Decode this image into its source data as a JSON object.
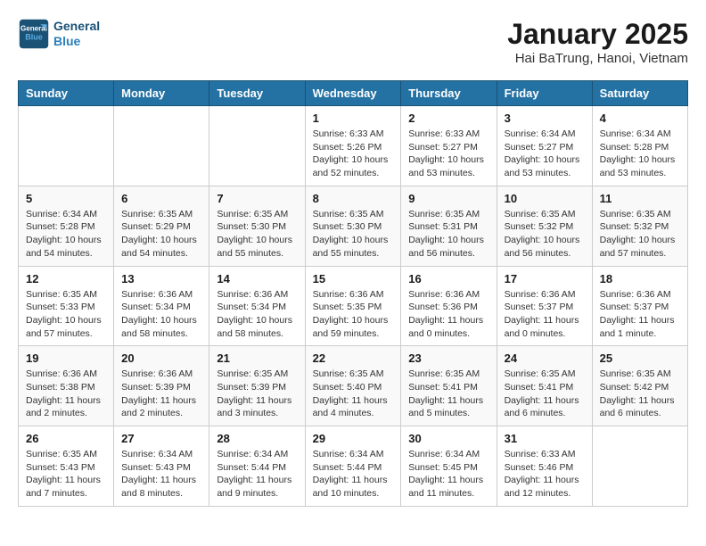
{
  "header": {
    "logo_line1": "General",
    "logo_line2": "Blue",
    "title": "January 2025",
    "subtitle": "Hai BaTrung, Hanoi, Vietnam"
  },
  "weekdays": [
    "Sunday",
    "Monday",
    "Tuesday",
    "Wednesday",
    "Thursday",
    "Friday",
    "Saturday"
  ],
  "weeks": [
    [
      {
        "day": "",
        "info": ""
      },
      {
        "day": "",
        "info": ""
      },
      {
        "day": "",
        "info": ""
      },
      {
        "day": "1",
        "info": "Sunrise: 6:33 AM\nSunset: 5:26 PM\nDaylight: 10 hours\nand 52 minutes."
      },
      {
        "day": "2",
        "info": "Sunrise: 6:33 AM\nSunset: 5:27 PM\nDaylight: 10 hours\nand 53 minutes."
      },
      {
        "day": "3",
        "info": "Sunrise: 6:34 AM\nSunset: 5:27 PM\nDaylight: 10 hours\nand 53 minutes."
      },
      {
        "day": "4",
        "info": "Sunrise: 6:34 AM\nSunset: 5:28 PM\nDaylight: 10 hours\nand 53 minutes."
      }
    ],
    [
      {
        "day": "5",
        "info": "Sunrise: 6:34 AM\nSunset: 5:28 PM\nDaylight: 10 hours\nand 54 minutes."
      },
      {
        "day": "6",
        "info": "Sunrise: 6:35 AM\nSunset: 5:29 PM\nDaylight: 10 hours\nand 54 minutes."
      },
      {
        "day": "7",
        "info": "Sunrise: 6:35 AM\nSunset: 5:30 PM\nDaylight: 10 hours\nand 55 minutes."
      },
      {
        "day": "8",
        "info": "Sunrise: 6:35 AM\nSunset: 5:30 PM\nDaylight: 10 hours\nand 55 minutes."
      },
      {
        "day": "9",
        "info": "Sunrise: 6:35 AM\nSunset: 5:31 PM\nDaylight: 10 hours\nand 56 minutes."
      },
      {
        "day": "10",
        "info": "Sunrise: 6:35 AM\nSunset: 5:32 PM\nDaylight: 10 hours\nand 56 minutes."
      },
      {
        "day": "11",
        "info": "Sunrise: 6:35 AM\nSunset: 5:32 PM\nDaylight: 10 hours\nand 57 minutes."
      }
    ],
    [
      {
        "day": "12",
        "info": "Sunrise: 6:35 AM\nSunset: 5:33 PM\nDaylight: 10 hours\nand 57 minutes."
      },
      {
        "day": "13",
        "info": "Sunrise: 6:36 AM\nSunset: 5:34 PM\nDaylight: 10 hours\nand 58 minutes."
      },
      {
        "day": "14",
        "info": "Sunrise: 6:36 AM\nSunset: 5:34 PM\nDaylight: 10 hours\nand 58 minutes."
      },
      {
        "day": "15",
        "info": "Sunrise: 6:36 AM\nSunset: 5:35 PM\nDaylight: 10 hours\nand 59 minutes."
      },
      {
        "day": "16",
        "info": "Sunrise: 6:36 AM\nSunset: 5:36 PM\nDaylight: 11 hours\nand 0 minutes."
      },
      {
        "day": "17",
        "info": "Sunrise: 6:36 AM\nSunset: 5:37 PM\nDaylight: 11 hours\nand 0 minutes."
      },
      {
        "day": "18",
        "info": "Sunrise: 6:36 AM\nSunset: 5:37 PM\nDaylight: 11 hours\nand 1 minute."
      }
    ],
    [
      {
        "day": "19",
        "info": "Sunrise: 6:36 AM\nSunset: 5:38 PM\nDaylight: 11 hours\nand 2 minutes."
      },
      {
        "day": "20",
        "info": "Sunrise: 6:36 AM\nSunset: 5:39 PM\nDaylight: 11 hours\nand 2 minutes."
      },
      {
        "day": "21",
        "info": "Sunrise: 6:35 AM\nSunset: 5:39 PM\nDaylight: 11 hours\nand 3 minutes."
      },
      {
        "day": "22",
        "info": "Sunrise: 6:35 AM\nSunset: 5:40 PM\nDaylight: 11 hours\nand 4 minutes."
      },
      {
        "day": "23",
        "info": "Sunrise: 6:35 AM\nSunset: 5:41 PM\nDaylight: 11 hours\nand 5 minutes."
      },
      {
        "day": "24",
        "info": "Sunrise: 6:35 AM\nSunset: 5:41 PM\nDaylight: 11 hours\nand 6 minutes."
      },
      {
        "day": "25",
        "info": "Sunrise: 6:35 AM\nSunset: 5:42 PM\nDaylight: 11 hours\nand 6 minutes."
      }
    ],
    [
      {
        "day": "26",
        "info": "Sunrise: 6:35 AM\nSunset: 5:43 PM\nDaylight: 11 hours\nand 7 minutes."
      },
      {
        "day": "27",
        "info": "Sunrise: 6:34 AM\nSunset: 5:43 PM\nDaylight: 11 hours\nand 8 minutes."
      },
      {
        "day": "28",
        "info": "Sunrise: 6:34 AM\nSunset: 5:44 PM\nDaylight: 11 hours\nand 9 minutes."
      },
      {
        "day": "29",
        "info": "Sunrise: 6:34 AM\nSunset: 5:44 PM\nDaylight: 11 hours\nand 10 minutes."
      },
      {
        "day": "30",
        "info": "Sunrise: 6:34 AM\nSunset: 5:45 PM\nDaylight: 11 hours\nand 11 minutes."
      },
      {
        "day": "31",
        "info": "Sunrise: 6:33 AM\nSunset: 5:46 PM\nDaylight: 11 hours\nand 12 minutes."
      },
      {
        "day": "",
        "info": ""
      }
    ]
  ]
}
